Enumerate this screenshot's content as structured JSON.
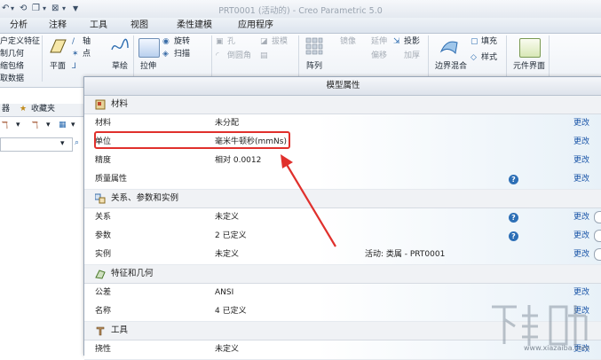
{
  "window": {
    "title": "PRT0001 (活动的) - Creo Parametric 5.0"
  },
  "tabs": [
    {
      "label": "分析"
    },
    {
      "label": "注释"
    },
    {
      "label": "工具"
    },
    {
      "label": "视图"
    },
    {
      "label": "柔性建模"
    },
    {
      "label": "应用程序"
    }
  ],
  "ribbon": {
    "left_items": [
      "户定义特征",
      "制几何",
      "缩包络",
      "取数据"
    ],
    "plane": "平面",
    "axis": "轴",
    "point": "点",
    "sketch": "草绘",
    "extrude": "拉伸",
    "revolve": "旋转",
    "sweep": "扫描",
    "hole": "孔",
    "round": "倒圆角",
    "draft": "拔模",
    "pattern": "阵列",
    "mirror": "镜像",
    "extend": "延伸",
    "project": "投影",
    "offset": "偏移",
    "thicken": "加厚",
    "boundary_blend": "边界混合",
    "fill": "填充",
    "style": "样式",
    "component_interface": "元件界面"
  },
  "left_panel": {
    "tab_label": "器",
    "favorites_label": "收藏夹",
    "search_placeholder": ""
  },
  "dialog": {
    "title": "模型属性",
    "edit_label": "更改",
    "help_glyph": "?",
    "sections": [
      {
        "title": "材料",
        "rows": [
          {
            "key": "材料",
            "value": "未分配",
            "extra": ""
          },
          {
            "key": "单位",
            "value": "毫米牛顿秒(mmNs)",
            "extra": ""
          },
          {
            "key": "精度",
            "value": "相对 0.0012",
            "extra": ""
          },
          {
            "key": "质量属性",
            "value": "",
            "extra": ""
          }
        ]
      },
      {
        "title": "关系、参数和实例",
        "rows": [
          {
            "key": "关系",
            "value": "未定义",
            "extra": ""
          },
          {
            "key": "参数",
            "value": "2 已定义",
            "extra": ""
          },
          {
            "key": "实例",
            "value": "未定义",
            "extra": "活动: 类属 - PRT0001"
          }
        ]
      },
      {
        "title": "特征和几何",
        "rows": [
          {
            "key": "公差",
            "value": "ANSI",
            "extra": ""
          },
          {
            "key": "名称",
            "value": "4 已定义",
            "extra": ""
          }
        ]
      },
      {
        "title": "工具",
        "rows": [
          {
            "key": "挠性",
            "value": "未定义",
            "extra": ""
          }
        ]
      }
    ]
  },
  "watermark": {
    "text": "下载吧",
    "url": "www.xiazaiba.com"
  },
  "colors": {
    "highlight": "#e0302c",
    "link": "#1a55a8",
    "help": "#2d6fb6"
  }
}
